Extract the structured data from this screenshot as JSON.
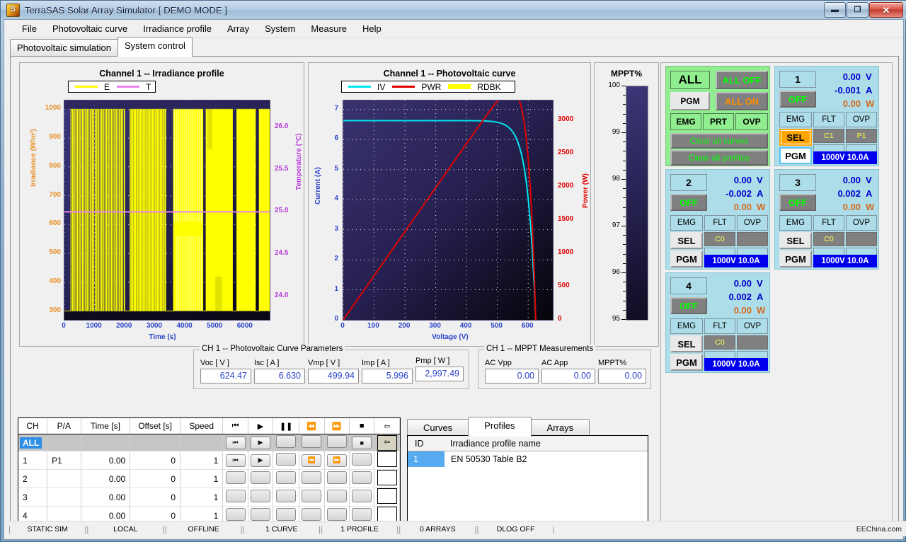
{
  "window": {
    "title": "TerraSAS Solar Array Simulator  [ DEMO MODE ]",
    "minimize": "—",
    "maximize": "▫",
    "close": "✕"
  },
  "menubar": {
    "items": [
      "File",
      "Photovoltaic curve",
      "Irradiance profile",
      "Array",
      "System",
      "Measure",
      "Help"
    ]
  },
  "tabs": {
    "items": [
      {
        "label": "Photovoltaic simulation",
        "active": false
      },
      {
        "label": "System control",
        "active": true
      }
    ]
  },
  "chart_data": [
    {
      "type": "line",
      "title": "Channel 1 -- Irradiance profile",
      "xlabel": "Time (s)",
      "ylabel": "Irradiance (W/m²)",
      "y2label": "Temperature (°C)",
      "legend": [
        {
          "name": "E",
          "color": "#ffff00"
        },
        {
          "name": "T",
          "color": "#ee82ee"
        }
      ],
      "legend_position": "top-left",
      "grid": true,
      "xlim": [
        0,
        6800
      ],
      "xticks": [
        0,
        1000,
        2000,
        3000,
        4000,
        5000,
        6000
      ],
      "ylim": [
        270,
        1030
      ],
      "yticks": [
        300,
        400,
        500,
        600,
        700,
        800,
        900,
        1000
      ],
      "y2lim": [
        23.72,
        26.32
      ],
      "y2ticks": [
        24.0,
        24.5,
        25.0,
        25.5,
        26.0
      ],
      "series": [
        {
          "name": "T",
          "constant_value": 25.0,
          "color": "#ee82ee"
        },
        {
          "name": "E",
          "color": "#ffff00",
          "note": "EN 50530 Table B2 square/ramp irradiance sequence cycling between 300 and 1000 W/m²"
        }
      ],
      "e_segments": [
        {
          "x0": 220,
          "x1": 2040,
          "kind": "fast-square",
          "count": 17,
          "low": 300,
          "high": 1000
        },
        {
          "x0": 2180,
          "x1": 3390,
          "kind": "fast-square",
          "count": 14,
          "low": 300,
          "high": 1000
        },
        {
          "x0": 3620,
          "x1": 4580,
          "kind": "ramp-block",
          "low": 300,
          "high": 1000
        },
        {
          "x0": 4700,
          "x1": 5560,
          "kind": "block",
          "low": 300,
          "high": 1000
        },
        {
          "x0": 5720,
          "x1": 6320,
          "kind": "block",
          "low": 300,
          "high": 1000
        },
        {
          "x0": 6460,
          "x1": 6800,
          "kind": "block",
          "low": 300,
          "high": 1000
        }
      ]
    },
    {
      "type": "line",
      "title": "Channel 1 -- Photovoltaic curve",
      "xlabel": "Voltage (V)",
      "ylabel": "Current (A)",
      "y2label": "Power (W)",
      "legend": [
        {
          "name": "IV",
          "color": "#00e5ee"
        },
        {
          "name": "PWR",
          "color": "#e00000"
        },
        {
          "name": "RDBK",
          "color": "#ffff00"
        }
      ],
      "legend_position": "top-left",
      "grid": true,
      "xlim": [
        0,
        680
      ],
      "xticks": [
        0,
        100,
        200,
        300,
        400,
        500,
        600
      ],
      "ylim": [
        0,
        7.3
      ],
      "yticks": [
        0,
        1,
        2,
        3,
        4,
        5,
        6,
        7
      ],
      "y2lim": [
        0,
        3300
      ],
      "y2ticks": [
        0,
        500,
        1000,
        1500,
        2000,
        2500,
        3000
      ],
      "series": [
        {
          "name": "IV",
          "color": "#00e5ee",
          "isc": 6.63,
          "voc": 624.47,
          "note": "flat near Isc then knee down to Voc"
        },
        {
          "name": "PWR",
          "color": "#e00000",
          "pmp": 2997.49,
          "vmp": 499.94,
          "note": "rises linearly then peaks at Vmp and falls to 0 at Voc"
        }
      ]
    },
    {
      "type": "bar",
      "title": "MPPT%",
      "orientation": "vertical-gauge",
      "ylim": [
        95,
        100
      ],
      "yticks": [
        95,
        96,
        97,
        98,
        99,
        100
      ],
      "value": 0.0
    }
  ],
  "curve_params": {
    "legend": "CH 1 -- Photovoltaic Curve Parameters",
    "fields": [
      {
        "label": "Voc [ V ]",
        "value": "624.47"
      },
      {
        "label": "Isc [ A ]",
        "value": "6.630"
      },
      {
        "label": "Vmp [ V ]",
        "value": "499.94"
      },
      {
        "label": "Imp [ A ]",
        "value": "5.996"
      },
      {
        "label": "Pmp [ W ]",
        "value": "2,997.49"
      }
    ]
  },
  "mppt_meas": {
    "legend": "CH 1 -- MPPT Measurements",
    "fields": [
      {
        "label": "AC Vpp",
        "value": "0.00"
      },
      {
        "label": "AC App",
        "value": "0.00"
      },
      {
        "label": "MPPT%",
        "value": "0.00"
      }
    ]
  },
  "channel_table": {
    "headers": [
      "CH",
      "P/A",
      "Time [s]",
      "Offset [s]",
      "Speed"
    ],
    "transport_headers": [
      "⏮",
      "▶",
      "❚❚",
      "⏪",
      "⏩",
      "■",
      "⇦"
    ],
    "rows": [
      {
        "ch": "ALL",
        "pa": "",
        "time": "",
        "offset": "",
        "speed": "",
        "buttons": [
          "⏮",
          "▶",
          "",
          "",
          "",
          "■"
        ],
        "back": "⇦",
        "all": true
      },
      {
        "ch": "1",
        "pa": "P1",
        "time": "0.00",
        "offset": "0",
        "speed": "1",
        "buttons": [
          "⏮",
          "▶",
          "",
          "⏪",
          "⏩",
          ""
        ],
        "back": ""
      },
      {
        "ch": "2",
        "pa": "",
        "time": "0.00",
        "offset": "0",
        "speed": "1",
        "buttons": [
          "",
          "",
          "",
          "",
          "",
          ""
        ],
        "back": ""
      },
      {
        "ch": "3",
        "pa": "",
        "time": "0.00",
        "offset": "0",
        "speed": "1",
        "buttons": [
          "",
          "",
          "",
          "",
          "",
          ""
        ],
        "back": ""
      },
      {
        "ch": "4",
        "pa": "",
        "time": "0.00",
        "offset": "0",
        "speed": "1",
        "buttons": [
          "",
          "",
          "",
          "",
          "",
          ""
        ],
        "back": ""
      }
    ]
  },
  "list_panel": {
    "tabs": [
      {
        "label": "Curves",
        "active": false
      },
      {
        "label": "Profiles",
        "active": true
      },
      {
        "label": "Arrays",
        "active": false
      }
    ],
    "headers": [
      "ID",
      "Irradiance profile  name"
    ],
    "rows": [
      {
        "id": "1",
        "name": "EN 50530 Table B2"
      }
    ]
  },
  "control_panel": {
    "all": {
      "title": "ALL",
      "pgm": "PGM",
      "all_off": "ALL OFF",
      "all_on": "ALL ON",
      "emg": "EMG",
      "prt": "PRT",
      "ovp": "OVP",
      "clear_curves": "Clear all curves",
      "clear_profiles": "Clear all profiles"
    },
    "channels": [
      {
        "num": "1",
        "state": "OFF",
        "volts": "0.00",
        "amps": "-0.001",
        "watts": "0.00",
        "v_unit": "V",
        "a_unit": "A",
        "w_unit": "W",
        "emg": "EMG",
        "flt": "FLT",
        "ovp": "OVP",
        "sel": "SEL",
        "pgm": "PGM",
        "curve": "C1",
        "profile": "P1",
        "array": "",
        "extra": "",
        "rating": "1000V 10.0A",
        "sel_active": true,
        "pgm_active": true
      },
      {
        "num": "2",
        "state": "OFF",
        "volts": "0.00",
        "amps": "-0.002",
        "watts": "0.00",
        "v_unit": "V",
        "a_unit": "A",
        "w_unit": "W",
        "emg": "EMG",
        "flt": "FLT",
        "ovp": "OVP",
        "sel": "SEL",
        "pgm": "PGM",
        "curve": "C0",
        "profile": "",
        "array": "",
        "extra": "",
        "rating": "1000V 10.0A",
        "sel_active": false,
        "pgm_active": false
      },
      {
        "num": "3",
        "state": "OFF",
        "volts": "0.00",
        "amps": "0.002",
        "watts": "0.00",
        "v_unit": "V",
        "a_unit": "A",
        "w_unit": "W",
        "emg": "EMG",
        "flt": "FLT",
        "ovp": "OVP",
        "sel": "SEL",
        "pgm": "PGM",
        "curve": "C0",
        "profile": "",
        "array": "",
        "extra": "",
        "rating": "1000V 10.0A",
        "sel_active": false,
        "pgm_active": false
      },
      {
        "num": "4",
        "state": "OFF",
        "volts": "0.00",
        "amps": "0.002",
        "watts": "0.00",
        "v_unit": "V",
        "a_unit": "A",
        "w_unit": "W",
        "emg": "EMG",
        "flt": "FLT",
        "ovp": "OVP",
        "sel": "SEL",
        "pgm": "PGM",
        "curve": "C0",
        "profile": "",
        "array": "",
        "extra": "",
        "rating": "1000V 10.0A",
        "sel_active": false,
        "pgm_active": false
      }
    ]
  },
  "statusbar": {
    "cells": [
      "STATIC SIM",
      "LOCAL",
      "OFFLINE",
      "1 CURVE",
      "1 PROFILE",
      "0 ARRAYS",
      "DLOG OFF"
    ],
    "watermark": "EEChina.com"
  },
  "colors": {
    "panel_all": "#90ee90",
    "panel_channel": "#addde8",
    "accent_orange": "#ffa500",
    "readout_blue": "#0000cd",
    "readout_watt": "#d2691e",
    "rating_bar": "#0000ee",
    "chart_irradiance": "#ffff00",
    "chart_temperature": "#ee82ee",
    "chart_iv": "#00e5ee",
    "chart_pwr": "#e00000"
  }
}
